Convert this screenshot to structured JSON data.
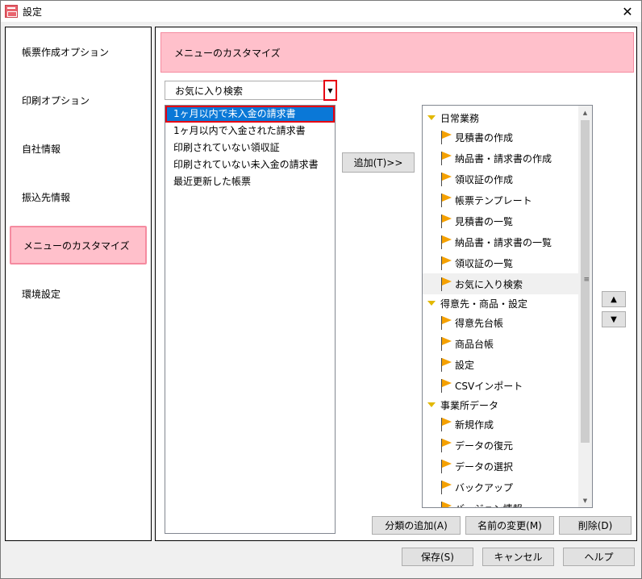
{
  "window": {
    "title": "設定"
  },
  "sidebar": {
    "items": [
      {
        "label": "帳票作成オプション"
      },
      {
        "label": "印刷オプション"
      },
      {
        "label": "自社情報"
      },
      {
        "label": "振込先情報"
      },
      {
        "label": "メニューのカスタマイズ",
        "active": true
      },
      {
        "label": "環境設定"
      }
    ]
  },
  "main": {
    "header": "メニューのカスタマイズ",
    "combo": {
      "value": "お気に入り検索"
    },
    "search_list": [
      "1ヶ月以内で未入金の請求書",
      "1ヶ月以内で入金された請求書",
      "印刷されていない領収証",
      "印刷されていない未入金の請求書",
      "最近更新した帳票"
    ],
    "add_button": "追加(T)>>",
    "tree": {
      "groups": [
        {
          "label": "日常業務",
          "items": [
            "見積書の作成",
            "納品書・請求書の作成",
            "領収証の作成",
            "帳票テンプレート",
            "見積書の一覧",
            "納品書・請求書の一覧",
            "領収証の一覧",
            "お気に入り検索"
          ]
        },
        {
          "label": "得意先・商品・設定",
          "items": [
            "得意先台帳",
            "商品台帳",
            "設定",
            "CSVインポート"
          ]
        },
        {
          "label": "事業所データ",
          "items": [
            "新規作成",
            "データの復元",
            "データの選択",
            "バックアップ",
            "バージョン情報"
          ]
        }
      ]
    },
    "move_up": "▲",
    "move_down": "▼",
    "buttons": {
      "add_category": "分類の追加(A)",
      "rename": "名前の変更(M)",
      "delete": "削除(D)"
    }
  },
  "footer": {
    "save": "保存(S)",
    "cancel": "キャンセル",
    "help": "ヘルプ"
  },
  "colors": {
    "accent_pink": "#ffc0cb",
    "selection_blue": "#0a78d7",
    "highlight_red": "#e60012",
    "flag_orange": "#f5a100"
  }
}
